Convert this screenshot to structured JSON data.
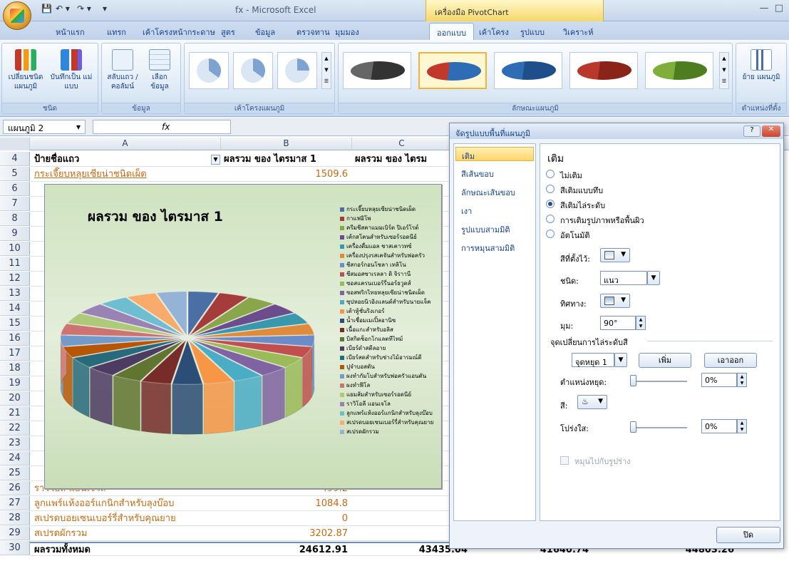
{
  "title_bar": {
    "doc_title": "fx - Microsoft Excel",
    "contextual_tools": "เครื่องมือ PivotChart",
    "qat_icons": [
      "save-icon",
      "undo-icon",
      "redo-icon"
    ]
  },
  "tabs": [
    "หน้าแรก",
    "แทรก",
    "เค้าโครงหน้ากระดาษ",
    "สูตร",
    "ข้อมูล",
    "ตรวจทาน",
    "มุมมอง",
    "ออกแบบ",
    "เค้าโครง",
    "รูปแบบ",
    "วิเคราะห์"
  ],
  "active_tab": "ออกแบบ",
  "ribbon": {
    "type_group": {
      "label": "ชนิด",
      "change_type": "เปลี่ยนชนิด แผนภูมิ",
      "save_template": "บันทึกเป็น แม่แบบ"
    },
    "data_group": {
      "label": "ข้อมูล",
      "switch": "สลับแถว /คอลัมน์",
      "select": "เลือก ข้อมูล"
    },
    "layouts_group": {
      "label": "เค้าโครงแผนภูมิ"
    },
    "styles_group": {
      "label": "ลักษณะแผนภูมิ"
    },
    "location_group": {
      "label": "ตำแหน่งที่ตั้ง",
      "move": "ย้าย แผนภูมิ"
    }
  },
  "formula_bar": {
    "name_box": "แผนภูมิ 2",
    "fx": "fx"
  },
  "columns": [
    "A",
    "B",
    "C"
  ],
  "grid": {
    "rows_visible": [
      "4",
      "5",
      "6",
      "7",
      "8",
      "9",
      "10",
      "11",
      "12",
      "13",
      "14",
      "15",
      "16",
      "17",
      "18",
      "19",
      "20",
      "21",
      "22",
      "23",
      "24",
      "25",
      "26",
      "27",
      "28",
      "29",
      "30"
    ],
    "header_row": {
      "row": "4",
      "a": "ป้ายชื่อแถว",
      "b": "ผลรวม ของ ไตรมาส 1",
      "c": "ผลรวม ของ ไตรม"
    },
    "row5": {
      "a": "กระเจี๊ยบหลุยเซียน่าชนิดเผ็ด",
      "b": "1509.6"
    },
    "row26": {
      "a": "ราวิโอลี แอนเจโล",
      "b": "499.2"
    },
    "row27": {
      "a": "ลูกแพร์แห้งออร์แกนิกสำหรับลุงบ๊อบ",
      "b": "1084.8"
    },
    "row28": {
      "a": "สเปรดบอยเซนเบอร์รี่สำหรับคุณยาย",
      "b": "0"
    },
    "row29": {
      "a": "สเปรดผักรวม",
      "b": "3202.87"
    },
    "row30": {
      "a": "ผลรวมทั้งหมด",
      "b": "24612.91",
      "c": "43435.04",
      "d": "41640.74",
      "e": "44803.26"
    }
  },
  "chart": {
    "title": "ผลรวม ของ ไตรมาส 1",
    "legend": [
      {
        "label": "กระเจี๊ยบหลุยเซียน่าชนิดเผ็ด",
        "color": "#4a6fa5"
      },
      {
        "label": "กาแฟอิโพ",
        "color": "#a63b3b"
      },
      {
        "label": "ครีมชีสคาแมมเบิร์ต ปิเอร์โรต์",
        "color": "#8aa64a"
      },
      {
        "label": "เค้กสโคนสำหรับเซอร์รอดนีย์",
        "color": "#6b4c8c"
      },
      {
        "label": "เครื่องดื่มแอล ชาสเคาวทซ์",
        "color": "#3a98ad"
      },
      {
        "label": "เครื่องปรุงรสเคจันสำหรับพ่อครัว",
        "color": "#e08a3c"
      },
      {
        "label": "ชีสกอร์กอนโซลา เทลิโน",
        "color": "#6a8cc8"
      },
      {
        "label": "ชีสมอสซาเรลลา ดิ จิราานี",
        "color": "#c0504d"
      },
      {
        "label": "ซอสแครนเบอร์รี่นอร์ธวูดส์",
        "color": "#9bbb59"
      },
      {
        "label": "ซอสพริกไทยหลุยเซียน่าชนิดเผ็ด",
        "color": "#8064a2"
      },
      {
        "label": "ซุปหอยนิวอิงแลนด์สำหรับนายแจ็ค",
        "color": "#4bacc6"
      },
      {
        "label": "เต้าหู้ชั่นริงเกอร์",
        "color": "#f79646"
      },
      {
        "label": "น้ำเชื่อมเมเปิ้ลอานิซ",
        "color": "#2c4d75"
      },
      {
        "label": "เนื้อแกะสำหรับอลิส",
        "color": "#772c2a"
      },
      {
        "label": "บิสกิตช็อกโกแลตทีไทม์",
        "color": "#5f7530"
      },
      {
        "label": "เบียร์ดำสตีลอาย",
        "color": "#4d3b62"
      },
      {
        "label": "เบียร์สดสำหรับช่างไม้อารมณ์ดี",
        "color": "#276a7c"
      },
      {
        "label": "ปูจำบอสตัน",
        "color": "#b65708"
      },
      {
        "label": "ผงทำกัมโบสำหรับพ่อครัวแอนตัน",
        "color": "#729aca"
      },
      {
        "label": "ผงทำฟีโล",
        "color": "#cd7371"
      },
      {
        "label": "แยมส้มสำหรับเซอร์รอดนีย์",
        "color": "#afc97a"
      },
      {
        "label": "ราวิโอลี แอนเจโล",
        "color": "#9983b5"
      },
      {
        "label": "ลูกแพร์แห้งออร์แกนิกสำหรับลุงบ๊อบ",
        "color": "#6fbdd1"
      },
      {
        "label": "สเปรดบอยเซนเบอร์รี่สำหรับคุณยาย",
        "color": "#f9ab6b"
      },
      {
        "label": "สเปรดผักรวม",
        "color": "#95b3d7"
      }
    ]
  },
  "dialog": {
    "title": "จัดรูปแบบพื้นที่แผนภูมิ",
    "nav": [
      "เติม",
      "สีเส้นขอบ",
      "ลักษณะเส้นขอบ",
      "เงา",
      "รูปแบบสามมิติ",
      "การหมุนสามมิติ"
    ],
    "section_title": "เติม",
    "options": [
      "ไม่เติม",
      "สีเติมแบบทึบ",
      "สีเติมไล่ระดับ",
      "การเติมรูปภาพหรือพื้นผิว",
      "อัตโนมัติ"
    ],
    "selected_option": "สีเติมไล่ระดับ",
    "preset_colors_label": "สีที่ตั้งไว้:",
    "type_label": "ชนิด:",
    "type_value": "แนว",
    "direction_label": "ทิศทาง:",
    "angle_label": "มุม:",
    "angle_value": "90°",
    "gradient_stops_label": "จุดเปลี่ยนการไล่ระดับสี",
    "stop_value": "จุดหยุด 1",
    "add_button": "เพิ่ม",
    "remove_button": "เอาออก",
    "stop_position_label": "ตำแหน่งหยุด:",
    "stop_position_value": "0%",
    "color_label": "สี:",
    "transparency_label": "โปร่งใส:",
    "transparency_value": "0%",
    "rotate_with_shape": "หมุนไปกับรูปร่าง",
    "close_button": "ปิด"
  }
}
